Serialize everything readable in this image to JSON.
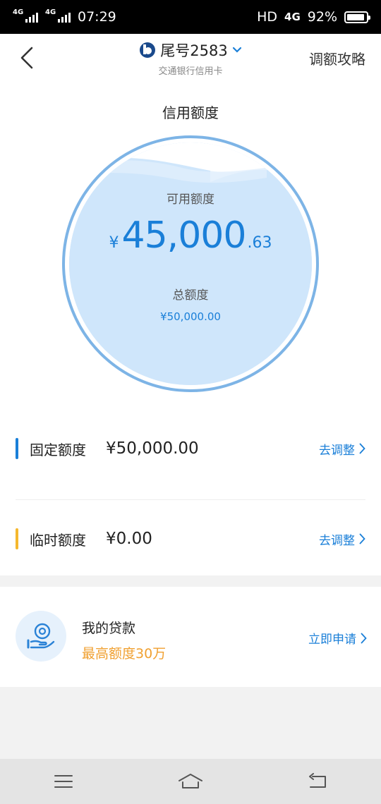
{
  "status_bar": {
    "network1": "4G",
    "network2": "4G",
    "time": "07:29",
    "hd": "HD",
    "network3": "4G",
    "battery": "92%",
    "battery_level": 0.92
  },
  "header": {
    "title": "尾号2583",
    "subtitle": "交通银行信用卡",
    "right_link": "调额攻略"
  },
  "credit": {
    "section_title": "信用额度",
    "available_label": "可用额度",
    "currency": "¥",
    "available_int": "45,000",
    "available_dec": ".63",
    "total_label": "总额度",
    "total_amount": "¥50,000.00"
  },
  "limits": [
    {
      "name": "固定额度",
      "value": "¥50,000.00",
      "action": "去调整",
      "color": "#1a7fd8"
    },
    {
      "name": "临时额度",
      "value": "¥0.00",
      "action": "去调整",
      "color": "#f5b82e"
    }
  ],
  "loan": {
    "title": "我的贷款",
    "subtitle": "最高额度30万",
    "action": "立即申请"
  },
  "colors": {
    "accent": "#1a7fd8",
    "orange": "#f0a030",
    "circle_fill": "#cfe6fb"
  }
}
